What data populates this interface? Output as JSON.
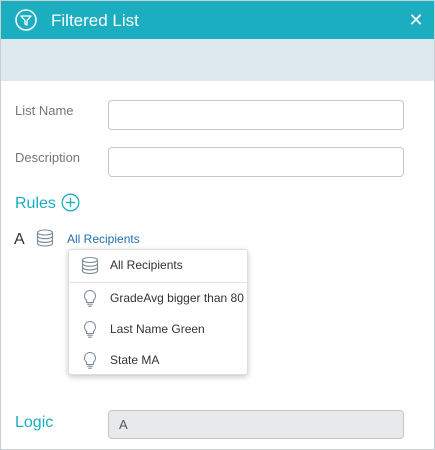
{
  "dialog": {
    "title": "Filtered List",
    "icons": {
      "title": "funnel-icon",
      "close": "close-icon"
    },
    "close_glyph": "✕"
  },
  "form": {
    "list_name": {
      "label": "List Name",
      "value": ""
    },
    "description": {
      "label": "Description",
      "value": ""
    }
  },
  "rules": {
    "title": "Rules",
    "items": [
      {
        "letter": "A",
        "icon": "database-icon",
        "link_label": "All Recipients"
      }
    ]
  },
  "dropdown": {
    "items": [
      {
        "label": "All Recipients",
        "icon": "database-icon"
      },
      {
        "label": "GradeAvg bigger than 80",
        "icon": "lightbulb-icon"
      },
      {
        "label": "Last Name Green",
        "icon": "lightbulb-icon"
      },
      {
        "label": "State MA",
        "icon": "lightbulb-icon"
      }
    ]
  },
  "logic": {
    "label": "Logic",
    "value": "A"
  },
  "colors": {
    "accent": "#1aaec0",
    "band": "#dde8ef",
    "link": "#1f6fb4"
  }
}
